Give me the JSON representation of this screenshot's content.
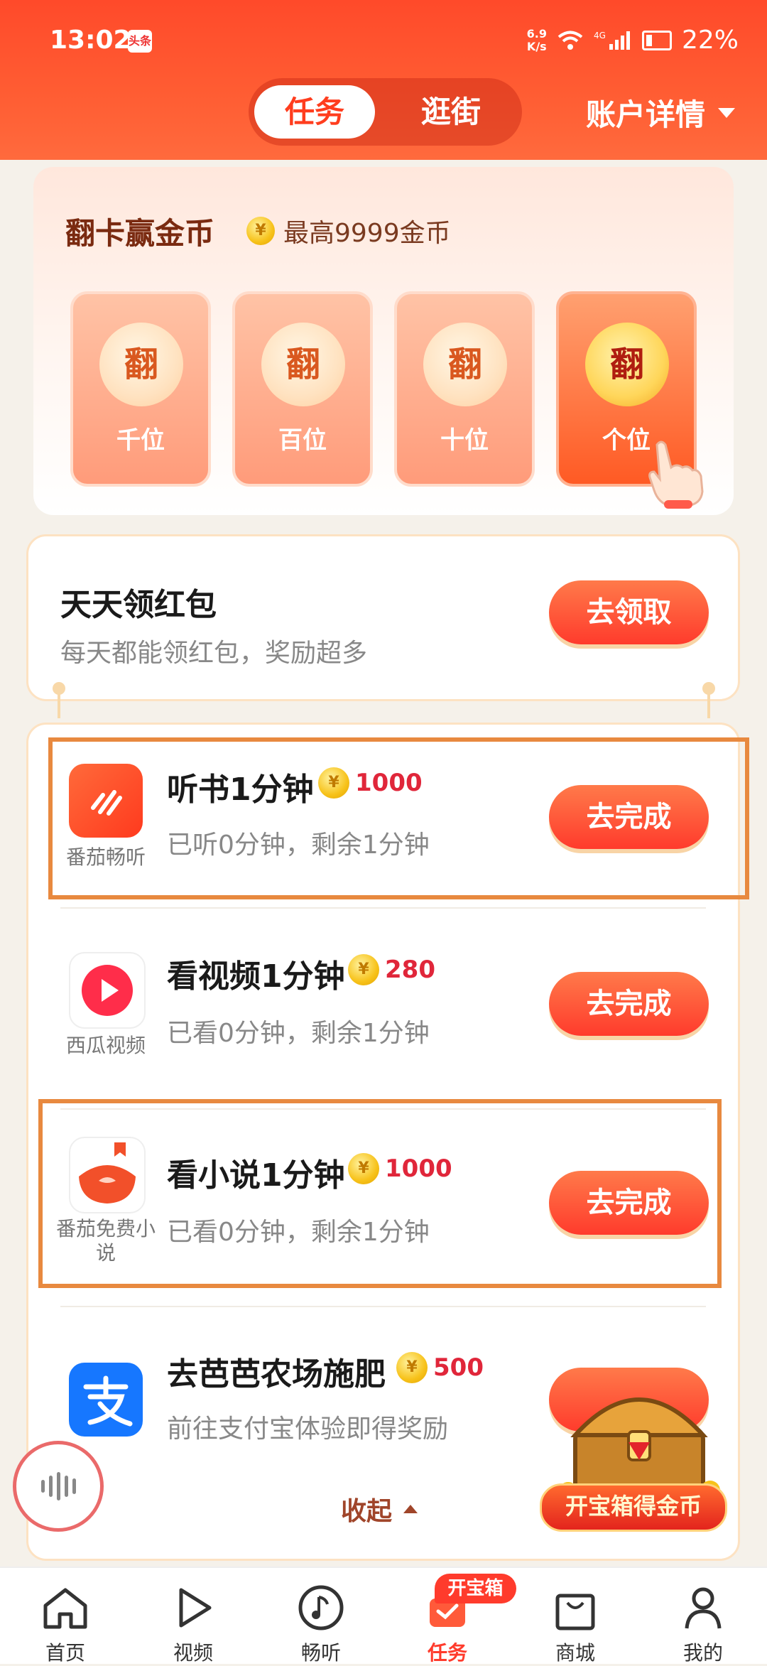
{
  "status_bar": {
    "time": "13:02",
    "app_badge": "头条",
    "net_speed_value": "6.9",
    "net_speed_unit": "K/s",
    "signal": "4G",
    "battery": "22%"
  },
  "header": {
    "tabs": [
      "任务",
      "逛街"
    ],
    "active_tab": "任务",
    "account": "账户详情"
  },
  "flip_card": {
    "title": "翻卡赢金币",
    "coin_symbol": "¥",
    "subtitle": "最高9999金币",
    "slot_glyph": "翻",
    "slots": [
      "千位",
      "百位",
      "十位",
      "个位"
    ]
  },
  "hongbao": {
    "title": "天天领红包",
    "desc": "每天都能领红包，奖励超多",
    "button": "去领取"
  },
  "tasks": [
    {
      "app": "番茄畅听",
      "title": "听书1分钟",
      "reward": "1000",
      "desc": "已听0分钟，剩余1分钟",
      "button": "去完成",
      "icon": "fanqie-listen-icon",
      "color": "#ff4a2a"
    },
    {
      "app": "西瓜视频",
      "title": "看视频1分钟",
      "reward": "280",
      "desc": "已看0分钟，剩余1分钟",
      "button": "去完成",
      "icon": "xigua-video-icon",
      "color": "#ff2d4a"
    },
    {
      "app_line1": "番茄免费小",
      "app_line2": "说",
      "title": "看小说1分钟",
      "reward": "1000",
      "desc": "已看0分钟，剩余1分钟",
      "button": "去完成",
      "icon": "fanqie-novel-icon",
      "color": "#f2502a"
    },
    {
      "title": "去芭芭农场施肥",
      "reward": "500",
      "desc": "前往支付宝体验即得奖励",
      "icon": "alipay-icon",
      "color": "#1677ff"
    }
  ],
  "collapse": "收起",
  "treasure": {
    "label": "开宝箱得金币"
  },
  "tabbar": {
    "badge": "开宝箱",
    "items": [
      "首页",
      "视频",
      "畅听",
      "任务",
      "商城",
      "我的"
    ],
    "active": "任务"
  }
}
